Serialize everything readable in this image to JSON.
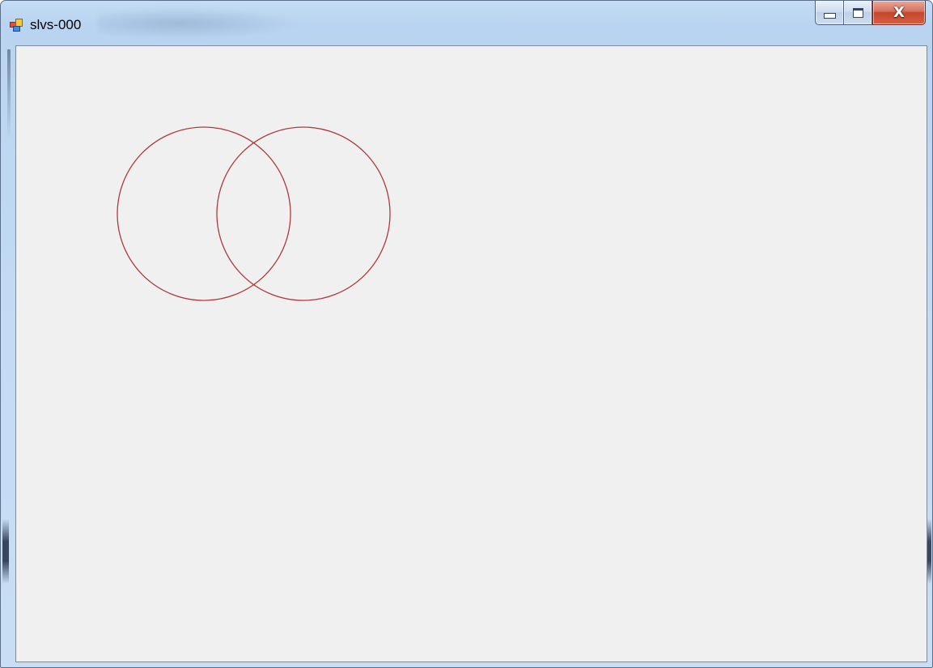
{
  "window": {
    "title": "slvs-000",
    "icon": "application-window-icon",
    "buttons": {
      "minimize": "minimize-icon",
      "maximize": "maximize-icon",
      "close": "close-icon",
      "close_glyph": "X"
    }
  },
  "canvas": {
    "background": "#f0f0f0",
    "stroke_color": "#b03a3a",
    "shapes": [
      {
        "type": "circle",
        "name": "left-circle"
      },
      {
        "type": "circle",
        "name": "right-circle"
      }
    ]
  }
}
